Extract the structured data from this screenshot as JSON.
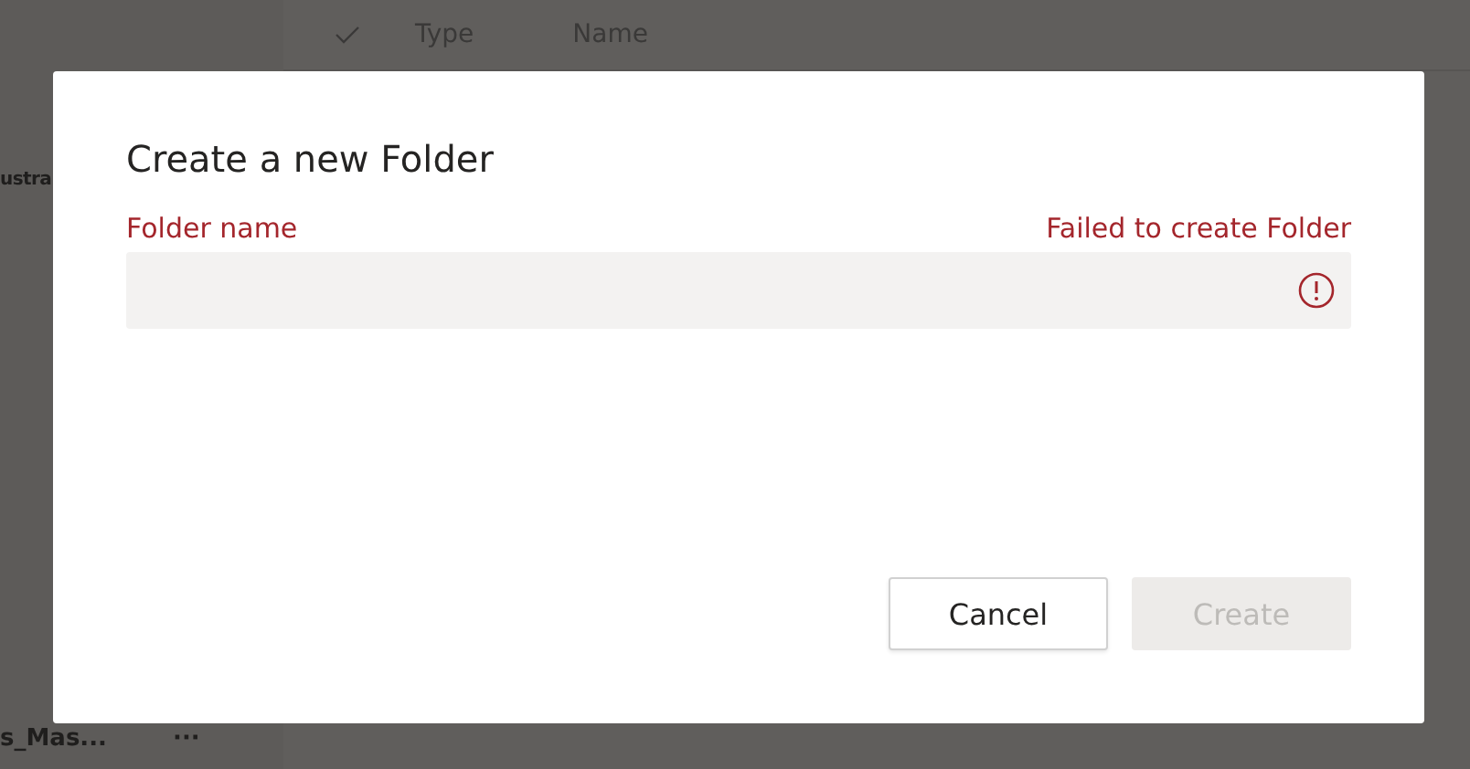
{
  "background": {
    "columns": [
      {
        "label": "Type"
      },
      {
        "label": "Name"
      }
    ],
    "sidebar_items": [
      {
        "label": "ustra"
      },
      {
        "label": "s_Mas...",
        "more": "···"
      }
    ]
  },
  "dialog": {
    "title": "Create a new Folder",
    "field": {
      "label": "Folder name",
      "error": "Failed to create Folder"
    },
    "buttons": [
      {
        "label": "Cancel",
        "kind": "secondary",
        "disabled": false
      },
      {
        "label": "Create",
        "kind": "primary",
        "disabled": true
      }
    ]
  }
}
